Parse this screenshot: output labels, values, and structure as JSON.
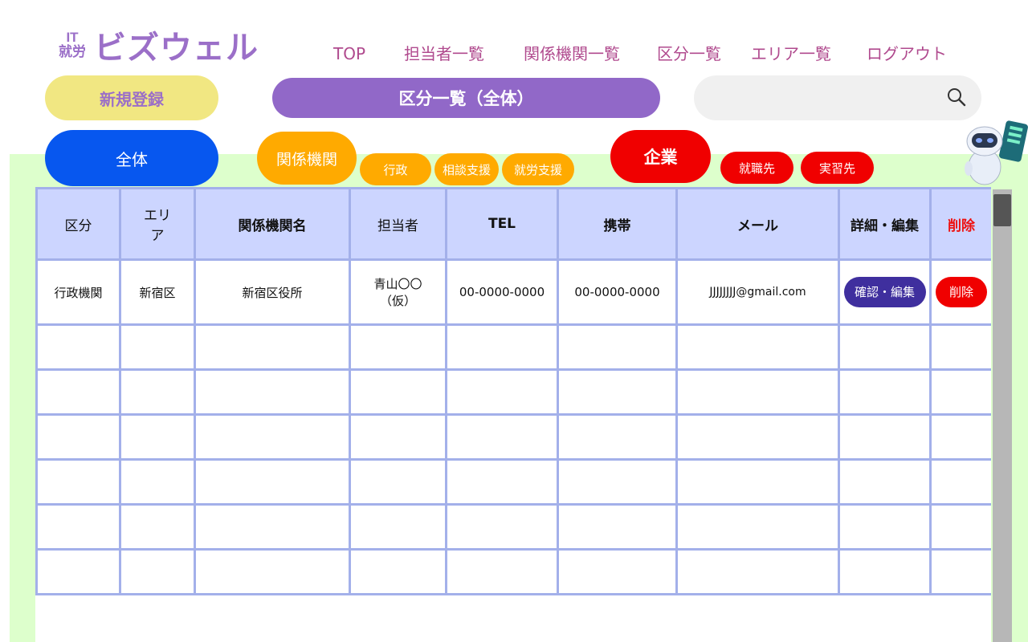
{
  "logo": {
    "prefix_line1": "IT",
    "prefix_line2": "就労",
    "name": "ビズウェル"
  },
  "nav": [
    {
      "label": "TOP"
    },
    {
      "label": "担当者一覧"
    },
    {
      "label": "関係機関一覧"
    },
    {
      "label": "区分一覧"
    },
    {
      "label": "エリア一覧"
    },
    {
      "label": "ログアウト"
    }
  ],
  "new_register_label": "新規登録",
  "page_title": "区分一覧（全体）",
  "search": {
    "value": "",
    "icon": "search-icon"
  },
  "filters": {
    "all": "全体",
    "kankei": "関係機関",
    "kankei_sub": [
      "行政",
      "相談支援",
      "就労支援"
    ],
    "kigyo": "企業",
    "kigyo_sub": [
      "就職先",
      "実習先"
    ]
  },
  "table": {
    "headers": [
      "区分",
      "エリア",
      "関係機関名",
      "担当者",
      "TEL",
      "携帯",
      "メール",
      "詳細・編集",
      "削除"
    ],
    "rows": [
      {
        "kubun": "行政機関",
        "area": "新宿区",
        "org": "新宿区役所",
        "person": "青山〇〇（仮）",
        "tel": "00-0000-0000",
        "mobile": "00-0000-0000",
        "email": "JJJJJJJJ@gmail.com",
        "edit_label": "確認・編集",
        "delete_label": "削除"
      }
    ],
    "empty_row_count": 6
  },
  "colors": {
    "accent_purple": "#9168c8",
    "yellow": "#f1e782",
    "blue": "#0757ef",
    "orange": "#ffaa00",
    "red": "#f00000",
    "green_bg": "#ddffcc",
    "table_header": "#ccd5ff",
    "table_border": "#a3b0ea",
    "edit_button": "#3f2f9e"
  }
}
